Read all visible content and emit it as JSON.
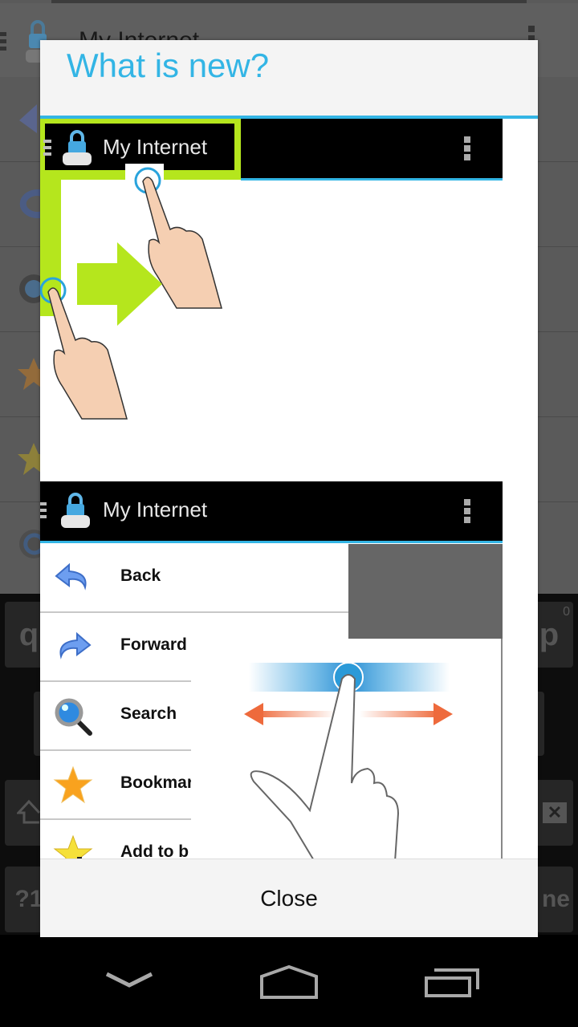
{
  "background_app": {
    "title": "My Internet",
    "rows": [
      "back-icon",
      "forward-icon",
      "search-icon",
      "bookmarks-icon",
      "add-bookmark-icon",
      "refresh-icon"
    ]
  },
  "keyboard": {
    "keys": [
      {
        "label": "q",
        "name": "key-q"
      },
      {
        "label": "p",
        "name": "key-p",
        "hint": "0"
      },
      {
        "label": "?1",
        "name": "key-symbols"
      },
      {
        "label": "ne",
        "name": "key-done"
      }
    ]
  },
  "dialog": {
    "title": "What is new?",
    "close_label": "Close",
    "illustration1": {
      "app_title": "My Internet",
      "caption": "swipe-from-left-edge-gesture"
    },
    "illustration2": {
      "app_title": "My Internet",
      "menu_items": [
        {
          "label": "Back",
          "icon": "back-arrow-icon"
        },
        {
          "label": "Forward",
          "icon": "forward-arrow-icon"
        },
        {
          "label": "Search",
          "icon": "magnifier-icon"
        },
        {
          "label": "Bookmar",
          "icon": "star-icon"
        },
        {
          "label": "Add to b",
          "icon": "star-plus-icon"
        }
      ]
    }
  },
  "colors": {
    "accent": "#33b5e5",
    "highlight_green": "#b5e61d",
    "swipe_arrow": "#ee6a3c"
  },
  "navbar": {
    "buttons": [
      "back-icon",
      "home-icon",
      "recents-icon"
    ]
  }
}
